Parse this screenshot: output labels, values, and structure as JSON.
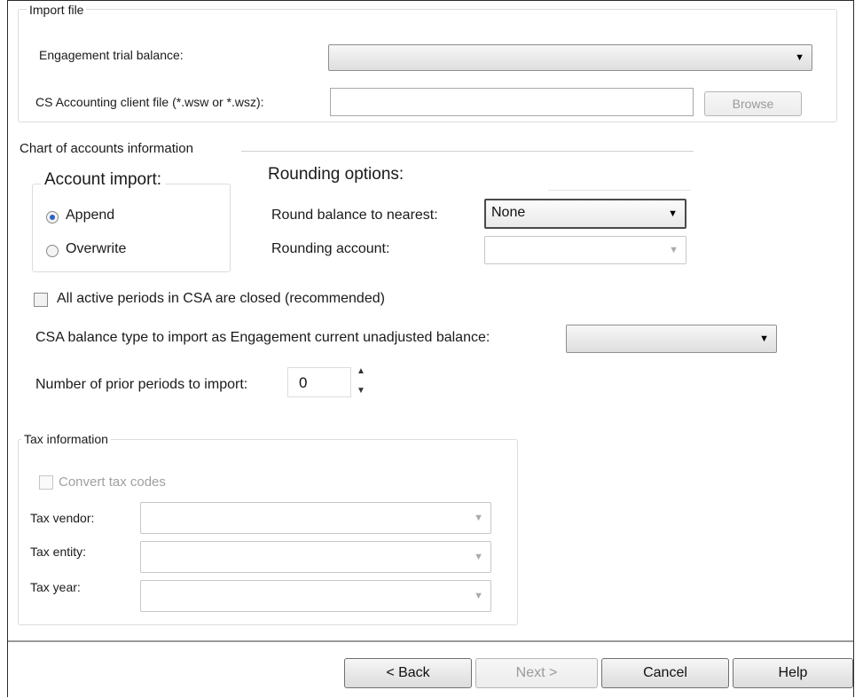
{
  "import_file": {
    "legend": "Import file",
    "trial_balance_label": "Engagement trial balance:",
    "trial_balance_value": "",
    "client_file_label": "CS Accounting  client file (*.wsw or *.wsz):",
    "client_file_value": "",
    "browse_label": "Browse"
  },
  "chart_of_accounts": {
    "legend": "Chart of accounts information",
    "account_import": {
      "title": "Account import:",
      "append_label": "Append",
      "overwrite_label": "Overwrite",
      "selected": "Append"
    },
    "rounding": {
      "title": "Rounding options:",
      "round_label": "Round balance to nearest:",
      "round_value": "None",
      "account_label": "Rounding account:",
      "account_value": ""
    },
    "periods_closed_label": "All active periods in CSA are closed (recommended)",
    "balance_type_label": "CSA balance type to import as Engagement current unadjusted balance:",
    "balance_type_value": "",
    "prior_periods_label": "Number of prior periods to import:",
    "prior_periods_value": "0"
  },
  "tax_info": {
    "legend": "Tax information",
    "convert_label": "Convert tax codes",
    "vendor_label": "Tax vendor:",
    "entity_label": "Tax entity:",
    "year_label": "Tax year:"
  },
  "footer": {
    "back_label": "< Back",
    "next_label": "Next >",
    "cancel_label": "Cancel",
    "help_label": "Help"
  },
  "icons": {
    "dropdown": "chevron-down-icon",
    "spinner_up": "arrow-up-icon",
    "spinner_down": "arrow-down-icon"
  }
}
